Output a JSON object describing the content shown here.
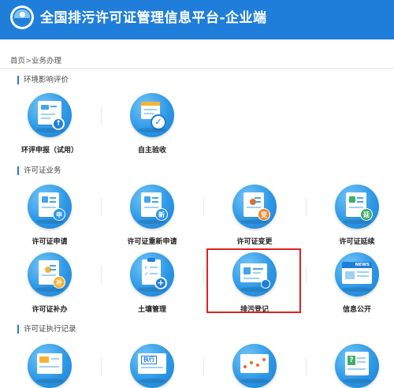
{
  "header": {
    "title": "全国排污许可证管理信息平台-企业端"
  },
  "breadcrumb": {
    "home": "首页",
    "separator": ">",
    "current": "业务办理"
  },
  "sections": [
    {
      "title": "环境影响评价"
    },
    {
      "title": "许可证业务"
    },
    {
      "title": "许可证执行记录"
    }
  ],
  "tiles": {
    "eia": [
      {
        "label": "环评申报（试用）",
        "icon": "report-upload-icon"
      },
      {
        "label": "自主验收",
        "icon": "calendar-check-icon"
      }
    ],
    "permit": [
      {
        "label": "许可证申请",
        "icon": "permit-apply-icon",
        "badge": "申"
      },
      {
        "label": "许可证重新申请",
        "icon": "permit-reapply-icon",
        "badge": "新"
      },
      {
        "label": "许可证变更",
        "icon": "permit-change-icon",
        "badge": "变"
      },
      {
        "label": "许可证延续",
        "icon": "permit-extend-icon",
        "badge": "延"
      },
      {
        "label": "许可证补办",
        "icon": "permit-reissue-icon",
        "badge": "补"
      },
      {
        "label": "土壤管理",
        "icon": "soil-checklist-icon"
      },
      {
        "label": "排污登记",
        "icon": "pollution-registration-icon"
      },
      {
        "label": "信息公开",
        "icon": "news-disclosure-icon",
        "badge": "NEWS"
      }
    ],
    "records": [
      {
        "icon": "execution-report-icon"
      },
      {
        "icon": "execution-stamp-icon",
        "badge": "执行"
      },
      {
        "icon": "monitoring-chart-icon"
      },
      {
        "icon": "question-doc-icon",
        "badge": "?"
      }
    ]
  },
  "colors": {
    "brand": "#1f7ed9",
    "highlight": "#e02020",
    "seal_blue": "#2d98e6",
    "seal_orange": "#f08a2c",
    "seal_green": "#3fae6a"
  }
}
